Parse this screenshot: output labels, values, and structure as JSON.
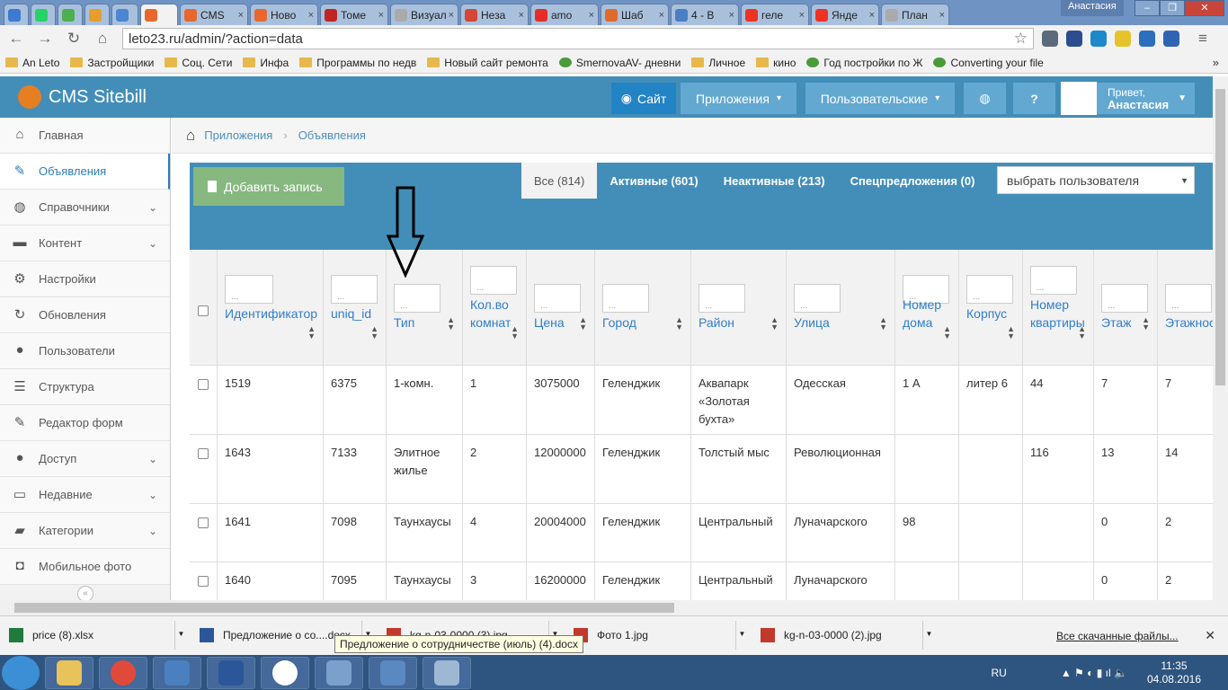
{
  "browser": {
    "tabs": [
      {
        "label": "",
        "icon": "mail-icon",
        "color": "#3d7bd1",
        "active": false
      },
      {
        "label": "",
        "icon": "whatsapp-icon",
        "color": "#25d366",
        "active": false
      },
      {
        "label": "",
        "icon": "pulse-icon",
        "color": "#4caf50",
        "active": false
      },
      {
        "label": "",
        "icon": "app-icon",
        "color": "#e89c2d",
        "active": false
      },
      {
        "label": "",
        "icon": "avito-icon",
        "color": "#4a86d1",
        "active": false
      },
      {
        "label": "",
        "icon": "home-icon",
        "color": "#e8672d",
        "active": true
      },
      {
        "label": "CMS",
        "icon": "home-icon",
        "color": "#e8672d",
        "active": false
      },
      {
        "label": "Ново",
        "icon": "home-icon",
        "color": "#e8672d",
        "active": false
      },
      {
        "label": "Томе",
        "icon": "brand-icon",
        "color": "#c02424",
        "active": false
      },
      {
        "label": "Визуаль",
        "icon": "page-icon",
        "color": "#aaaaaa",
        "active": false
      },
      {
        "label": "Неза",
        "icon": "gmail-icon",
        "color": "#d44638",
        "active": false
      },
      {
        "label": "amo",
        "icon": "youtube-icon",
        "color": "#e52d27",
        "active": false
      },
      {
        "label": "Шаб",
        "icon": "s-icon",
        "color": "#e06a2a",
        "active": false
      },
      {
        "label": "4 - В",
        "icon": "mail-icon",
        "color": "#4b7fc4",
        "active": false
      },
      {
        "label": "геле",
        "icon": "yandex-icon",
        "color": "#e32",
        "active": false
      },
      {
        "label": "Янде",
        "icon": "yandex-icon",
        "color": "#e32",
        "active": false
      },
      {
        "label": "План",
        "icon": "page-icon",
        "color": "#aaaaaa",
        "active": false
      }
    ],
    "user_chip": "Анастасия",
    "window_controls": [
      "–",
      "❐",
      "✕"
    ],
    "address": "leto23.ru/admin/?action=data",
    "bookmarks": [
      {
        "label": "An Leto",
        "type": "folder"
      },
      {
        "label": "Застройщики",
        "type": "folder"
      },
      {
        "label": "Соц. Сети",
        "type": "folder"
      },
      {
        "label": "Инфа",
        "type": "folder"
      },
      {
        "label": "Программы по недв",
        "type": "folder"
      },
      {
        "label": "Новый сайт ремонта",
        "type": "folder"
      },
      {
        "label": "SmernovaAV- дневни",
        "type": "link"
      },
      {
        "label": "Личное",
        "type": "folder"
      },
      {
        "label": "кино",
        "type": "folder"
      },
      {
        "label": "Год постройки по Ж",
        "type": "link"
      },
      {
        "label": "Converting your file",
        "type": "link"
      }
    ],
    "bookmarks_more": "»"
  },
  "cms": {
    "brand": "CMS Sitebill",
    "site_button": "Сайт",
    "apps_button": "Приложения",
    "users_button": "Пользовательские",
    "greeting": "Привет,",
    "username": "Анастасия"
  },
  "sidebar": {
    "items": [
      {
        "label": "Главная",
        "icon": "home-icon",
        "active": false,
        "caret": false
      },
      {
        "label": "Объявления",
        "icon": "edit-icon",
        "active": true,
        "caret": false
      },
      {
        "label": "Справочники",
        "icon": "globe-icon",
        "active": false,
        "caret": true
      },
      {
        "label": "Контент",
        "icon": "keyboard-icon",
        "active": false,
        "caret": true
      },
      {
        "label": "Настройки",
        "icon": "gear-icon",
        "active": false,
        "caret": false
      },
      {
        "label": "Обновления",
        "icon": "refresh-icon",
        "active": false,
        "caret": false
      },
      {
        "label": "Пользователи",
        "icon": "user-icon",
        "active": false,
        "caret": false
      },
      {
        "label": "Структура",
        "icon": "list-icon",
        "active": false,
        "caret": false
      },
      {
        "label": "Редактор форм",
        "icon": "pencil-icon",
        "active": false,
        "caret": false
      },
      {
        "label": "Доступ",
        "icon": "users-icon",
        "active": false,
        "caret": true
      },
      {
        "label": "Недавние",
        "icon": "desktop-icon",
        "active": false,
        "caret": true
      },
      {
        "label": "Категории",
        "icon": "folder-icon",
        "active": false,
        "caret": true
      },
      {
        "label": "Мобильное фото",
        "icon": "camera-icon",
        "active": false,
        "caret": false
      }
    ],
    "collapse": "«"
  },
  "breadcrumb": {
    "items": [
      "Приложения",
      "Объявления"
    ],
    "separator": "›"
  },
  "toolbar": {
    "add_record": "Добавить запись",
    "filter_tabs": [
      {
        "label": "Все (814)",
        "active": true
      },
      {
        "label": "Активные (601)",
        "active": false
      },
      {
        "label": "Неактивные (213)",
        "active": false
      },
      {
        "label": "Спецпредложения (0)",
        "active": false
      }
    ],
    "user_select": "выбрать пользователя"
  },
  "table": {
    "filter_placeholder": "...",
    "columns": [
      "Идентификатор",
      "uniq_id",
      "Тип",
      "Кол.во комнат",
      "Цена",
      "Город",
      "Район",
      "Улица",
      "Номер дома",
      "Корпус",
      "Номер квартиры",
      "Этаж",
      "Этажность"
    ],
    "rows": [
      [
        "1519",
        "6375",
        "1-комн.",
        "1",
        "3075000",
        "Геленджик",
        "Аквапарк «Золотая бухта»",
        "Одесская",
        "1 А",
        "литер 6",
        "44",
        "7",
        "7"
      ],
      [
        "1643",
        "7133",
        "Элитное жилье",
        "2",
        "12000000",
        "Геленджик",
        "Толстый мыс",
        "Революционная",
        "",
        "",
        "116",
        "13",
        "14"
      ],
      [
        "1641",
        "7098",
        "Таунхаусы",
        "4",
        "20004000",
        "Геленджик",
        "Центральный",
        "Луначарского",
        "98",
        "",
        "",
        "0",
        "2"
      ],
      [
        "1640",
        "7095",
        "Таунхаусы",
        "3",
        "16200000",
        "Геленджик",
        "Центральный",
        "Луначарского",
        "",
        "",
        "",
        "0",
        "2"
      ]
    ]
  },
  "downloads": {
    "items": [
      "price (8).xlsx",
      "Предложение о со....docx",
      "kg-n-03-0000 (3).jpg",
      "Фото 1.jpg",
      "kg-n-03-0000 (2).jpg"
    ],
    "tooltip": "Предложение о сотрудничестве (июль) (4).docx",
    "all_label": "Все скачанные файлы...",
    "close": "✕"
  },
  "taskbar": {
    "lang": "RU",
    "time": "11:35",
    "date": "04.08.2016"
  }
}
